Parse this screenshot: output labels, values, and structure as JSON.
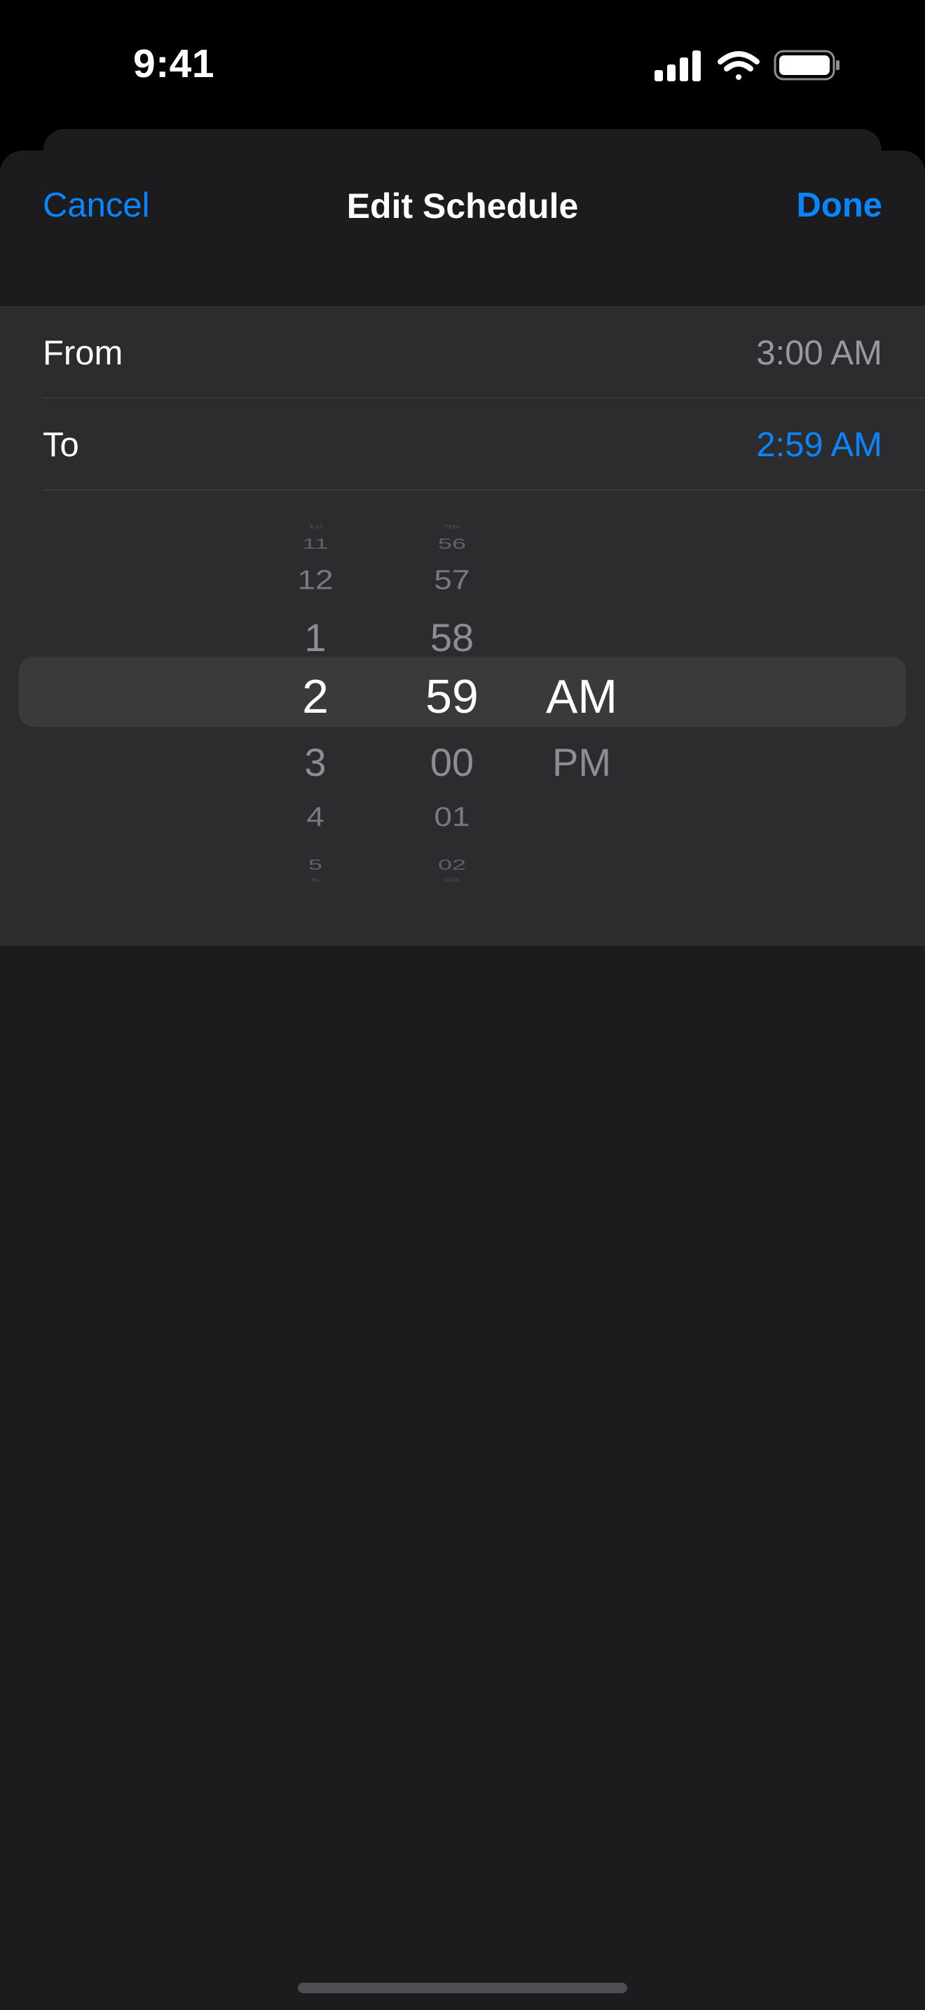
{
  "status_bar": {
    "time": "9:41",
    "icons": [
      "cellular-signal-icon",
      "wifi-icon",
      "battery-icon"
    ]
  },
  "sheet": {
    "title": "Edit Schedule",
    "cancel_label": "Cancel",
    "done_label": "Done"
  },
  "schedule": {
    "from": {
      "label": "From",
      "value": "3:00 AM"
    },
    "to": {
      "label": "To",
      "value": "2:59 AM"
    }
  },
  "picker": {
    "hours": [
      "10",
      "11",
      "12",
      "1",
      "2",
      "3",
      "4",
      "5",
      "6"
    ],
    "minutes": [
      "55",
      "56",
      "57",
      "58",
      "59",
      "00",
      "01",
      "02",
      "03"
    ],
    "ampm": [
      "AM",
      "PM"
    ],
    "selected": {
      "hour": "2",
      "minute": "59",
      "ampm": "AM"
    }
  },
  "colors": {
    "accent": "#0a84ff",
    "sheet_bg": "#1c1c1e",
    "group_bg": "#2c2c2e",
    "secondary_text": "#98989f"
  }
}
